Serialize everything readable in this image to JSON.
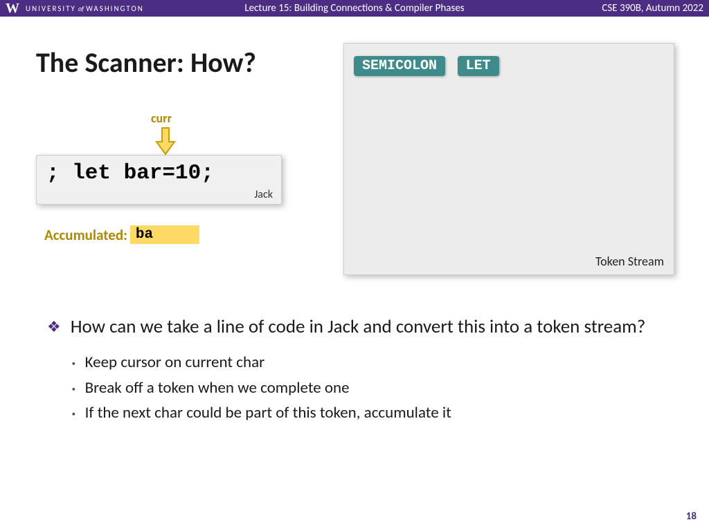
{
  "header": {
    "university_w": "W",
    "university_name_1": "UNIVERSITY",
    "university_of": "of",
    "university_name_2": "WASHINGTON",
    "lecture_title": "Lecture 15: Building Connections & Compiler Phases",
    "course": "CSE 390B, Autumn 2022"
  },
  "slide": {
    "title": "The Scanner: How?",
    "page_number": "18"
  },
  "scanner": {
    "curr_label": "curr",
    "code": "; let bar=10;",
    "code_lang": "Jack",
    "accumulated_label": "Accumulated:",
    "accumulated_value": "ba"
  },
  "token_stream": {
    "label": "Token Stream",
    "tokens": [
      "SEMICOLON",
      "LET"
    ]
  },
  "bullets": {
    "main": "How can we take a line of code in Jack and convert this into a token stream?",
    "subs": [
      "Keep cursor on current char",
      "Break off a token when we complete one",
      "If the next char could be part of this token, accumulate it"
    ]
  }
}
